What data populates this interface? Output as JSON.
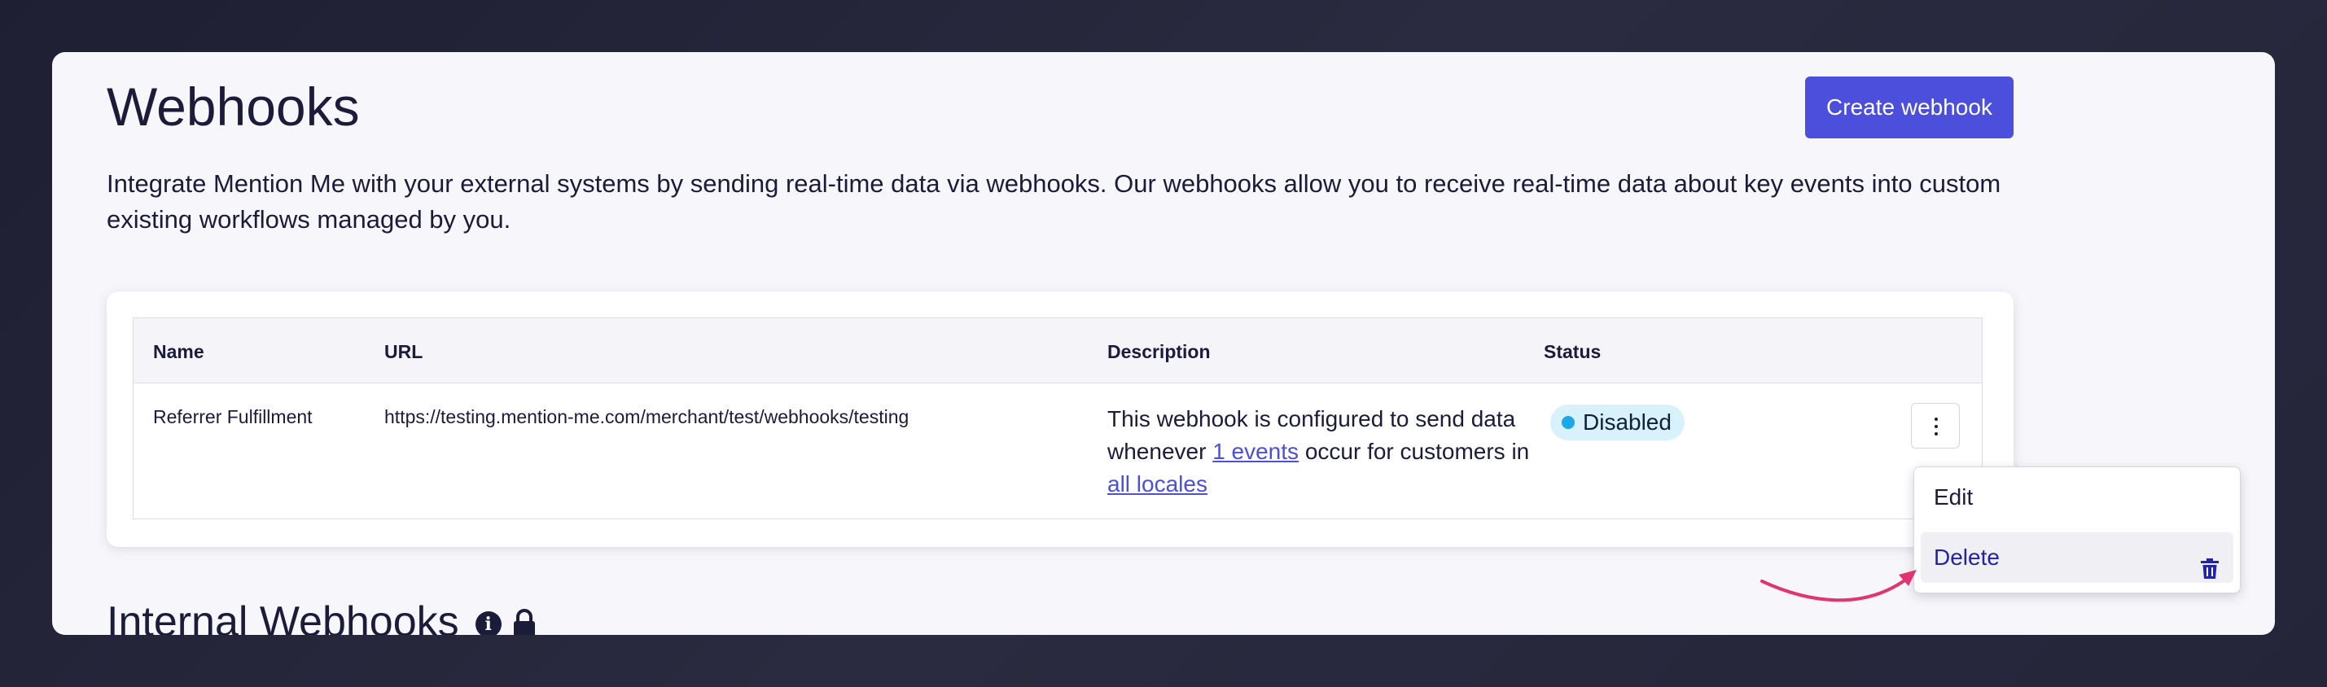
{
  "page": {
    "title": "Webhooks",
    "create_button_label": "Create webhook",
    "intro_text": "Integrate Mention Me with your external systems by sending real-time data via webhooks. Our webhooks allow you to receive real-time data about key events into custom existing workflows managed by you."
  },
  "table": {
    "headers": {
      "name": "Name",
      "url": "URL",
      "description": "Description",
      "status": "Status"
    },
    "rows": [
      {
        "name": "Referrer Fulfillment",
        "url": "https://testing.mention-me.com/merchant/test/webhooks/testing",
        "description_prefix": "This webhook is configured to send data whenever ",
        "events_link": "1 events",
        "description_middle": " occur for customers in ",
        "locales_link": "all locales",
        "status": "Disabled"
      }
    ]
  },
  "actions_menu": {
    "edit_label": "Edit",
    "delete_label": "Delete"
  },
  "internal_section": {
    "title": "Internal Webhooks"
  },
  "colors": {
    "primary": "#4b4fdc",
    "status_badge_bg": "#d8f1fb",
    "status_dot": "#1aa9e6",
    "arrow": "#e0356f",
    "delete_text": "#2323a8"
  },
  "icons": {
    "kebab": "kebab-menu-icon",
    "info": "info-icon",
    "lock": "lock-icon",
    "trash": "trash-icon",
    "arrow": "curved-arrow"
  }
}
